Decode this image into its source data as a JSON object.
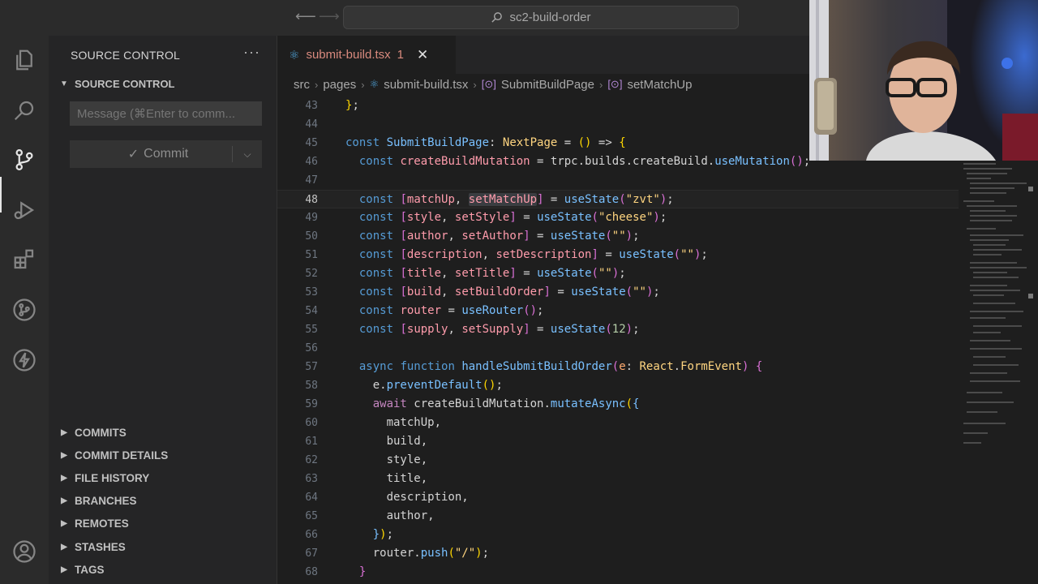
{
  "titlebar": {
    "search_text": "sc2-build-order"
  },
  "activity_bar": {
    "items": [
      "explorer-icon",
      "search-icon",
      "source-control-icon",
      "run-debug-icon",
      "extensions-icon",
      "git-graph-icon",
      "lightning-icon",
      "account-icon"
    ]
  },
  "sidebar": {
    "title": "SOURCE CONTROL",
    "more": "···",
    "section": "SOURCE CONTROL",
    "message_placeholder": "Message (⌘Enter to comm...",
    "commit_label": "Commit",
    "panels": [
      "COMMITS",
      "COMMIT DETAILS",
      "FILE HISTORY",
      "BRANCHES",
      "REMOTES",
      "STASHES",
      "TAGS"
    ]
  },
  "editor": {
    "tab": {
      "name": "submit-build.tsx",
      "badge": "1"
    },
    "breadcrumbs": {
      "folder1": "src",
      "folder2": "pages",
      "file": "submit-build.tsx",
      "symbol1": "SubmitBuildPage",
      "symbol2": "setMatchUp"
    },
    "line_numbers": [
      "43",
      "44",
      "45",
      "46",
      "47",
      "48",
      "49",
      "50",
      "51",
      "52",
      "53",
      "54",
      "55",
      "56",
      "57",
      "58",
      "59",
      "60",
      "61",
      "62",
      "63",
      "64",
      "65",
      "66",
      "67",
      "68"
    ],
    "current_line": "48"
  },
  "colors": {
    "accent_blue": "#4fa3d9",
    "tab_modified": "#d98a7e",
    "keyword": "#569cd6",
    "variable": "#ff9cac",
    "function": "#79c0ff",
    "string": "#ffd580"
  }
}
